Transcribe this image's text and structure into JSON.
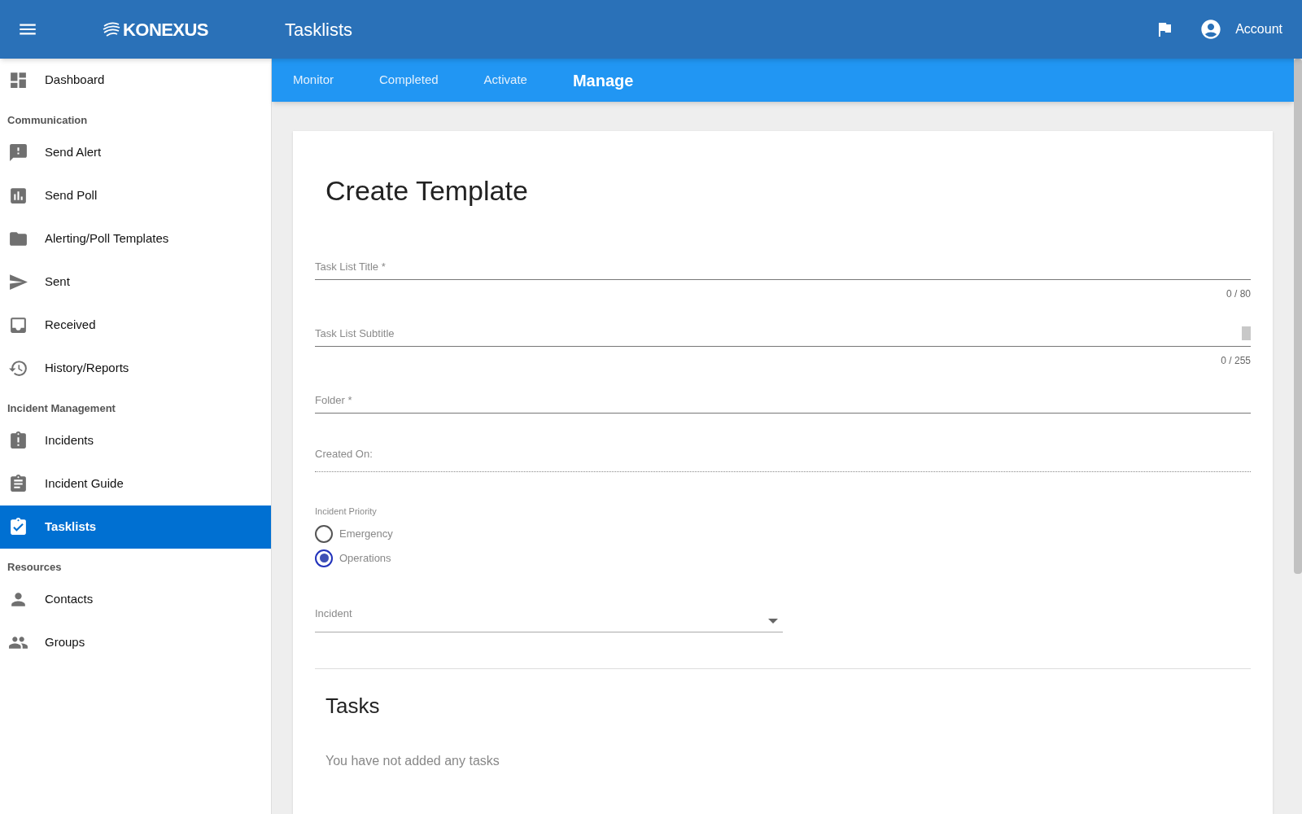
{
  "header": {
    "logo": "KONEXUS",
    "title": "Tasklists",
    "account": "Account"
  },
  "tabs": [
    {
      "label": "Monitor",
      "selected": false
    },
    {
      "label": "Completed",
      "selected": false
    },
    {
      "label": "Activate",
      "selected": false
    },
    {
      "label": "Manage",
      "selected": true
    }
  ],
  "sidebar": {
    "items": [
      {
        "kind": "link",
        "label": "Dashboard",
        "selected": false
      },
      {
        "kind": "heading",
        "label": "Communication"
      },
      {
        "kind": "link",
        "label": "Send Alert",
        "selected": false
      },
      {
        "kind": "link",
        "label": "Send Poll",
        "selected": false
      },
      {
        "kind": "link",
        "label": "Alerting/Poll Templates",
        "selected": false
      },
      {
        "kind": "link",
        "label": "Sent",
        "selected": false
      },
      {
        "kind": "link",
        "label": "Received",
        "selected": false
      },
      {
        "kind": "link",
        "label": "History/Reports",
        "selected": false
      },
      {
        "kind": "heading",
        "label": "Incident Management"
      },
      {
        "kind": "link",
        "label": "Incidents",
        "selected": false
      },
      {
        "kind": "link",
        "label": "Incident Guide",
        "selected": false
      },
      {
        "kind": "link",
        "label": "Tasklists",
        "selected": true
      },
      {
        "kind": "heading",
        "label": "Resources"
      },
      {
        "kind": "link",
        "label": "Contacts",
        "selected": false
      },
      {
        "kind": "link",
        "label": "Groups",
        "selected": false
      }
    ]
  },
  "form": {
    "title": "Create Template",
    "fields": [
      {
        "kind": "text",
        "placeholder": "Task List Title *",
        "counter": "0 / 80"
      },
      {
        "kind": "textarea",
        "placeholder": "Task List Subtitle",
        "counter": "0 / 255"
      },
      {
        "kind": "text",
        "placeholder": "Folder *"
      },
      {
        "kind": "readonly",
        "label": "Created On:"
      },
      {
        "kind": "radio",
        "label": "Incident Priority",
        "options": [
          {
            "label": "Emergency",
            "selected": false
          },
          {
            "label": "Operations",
            "selected": true
          }
        ]
      },
      {
        "kind": "select",
        "placeholder": "Incident"
      }
    ],
    "tasks": {
      "title": "Tasks",
      "empty": "You have not added any tasks"
    }
  }
}
